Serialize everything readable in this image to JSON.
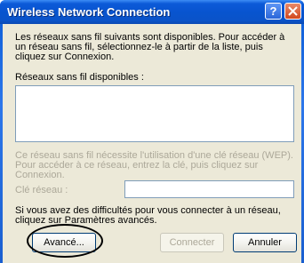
{
  "window": {
    "title": "Wireless Network Connection"
  },
  "titlebar_buttons": {
    "help_label": "?",
    "close_icon": "close-icon"
  },
  "intro": {
    "text": "Les réseaux sans fil suivants sont disponibles. Pour accéder à un réseau sans fil, sélectionnez-le à partir de la liste, puis cliquez sur Connexion."
  },
  "networks": {
    "label": "Réseaux sans fil disponibles :",
    "items": []
  },
  "wep_notice": {
    "text": "Ce réseau sans fil nécessite l'utilisation d'une clé réseau (WEP). Pour accéder à ce réseau, entrez la clé, puis cliquez sur Connexion."
  },
  "network_key": {
    "label": "Clé réseau :",
    "value": ""
  },
  "help_text": {
    "text": "Si vous avez des difficultés pour vous connecter à un réseau, cliquez sur Paramètres avancés."
  },
  "buttons": {
    "advanced": "Avancé...",
    "connect": "Connecter",
    "cancel": "Annuler"
  },
  "colors": {
    "titlebar": "#0a53c9",
    "dialog_bg": "#ece9d8",
    "disabled_text": "#aca899"
  }
}
